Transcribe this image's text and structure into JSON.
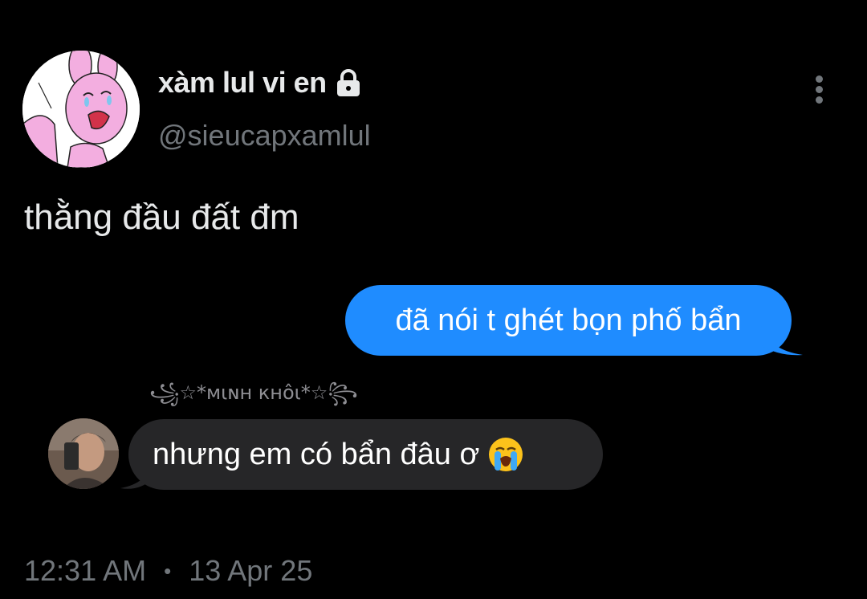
{
  "profile": {
    "display_name": "xàm lul vi en",
    "handle": "@sieucapxamlul",
    "avatar_icon": "pink-bunny-crying-avatar",
    "lock_icon": "lock-icon"
  },
  "tweet": {
    "text": "thằng đầu đất đm",
    "more_icon": "more-vertical-icon"
  },
  "chat": {
    "outgoing_message": "đã nói t ghét bọn phố bẩn",
    "sender_name": "꧁☆*мιɴн кнôι*☆꧂",
    "incoming_message": "nhưng em có bẩn đâu ơ",
    "incoming_emoji": "loudly-crying-face-icon",
    "outgoing_color": "#1f8cff",
    "incoming_color": "#262628"
  },
  "meta": {
    "time": "12:31 AM",
    "separator": "•",
    "date": "13 Apr 25"
  }
}
